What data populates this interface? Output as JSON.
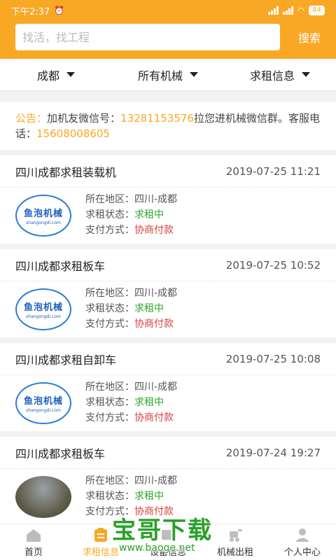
{
  "status": {
    "time": "下午2:37",
    "battery": "84"
  },
  "search": {
    "placeholder": "找活，找工程",
    "button": "搜索"
  },
  "filters": [
    {
      "label": "成都"
    },
    {
      "label": "所有机械"
    },
    {
      "label": "求租信息"
    }
  ],
  "notice": {
    "label": "公告：",
    "text1": "加机友微信号：",
    "wechat": "13281153576",
    "text2": "拉您进机械微信群。客服电话：",
    "phone": "15608008605"
  },
  "field_labels": {
    "region": "所在地区：",
    "status": "求租状态：",
    "payment": "支付方式："
  },
  "listings": [
    {
      "title": "四川成都求租装载机",
      "time": "2019-07-25 11:21",
      "region": "四川-成都",
      "status": "求租中",
      "payment": "协商付款",
      "thumb": "logo"
    },
    {
      "title": "四川成都求租板车",
      "time": "2019-07-25 10:52",
      "region": "四川-成都",
      "status": "求租中",
      "payment": "协商付款",
      "thumb": "logo"
    },
    {
      "title": "四川成都求租自卸车",
      "time": "2019-07-25 10:08",
      "region": "四川-成都",
      "status": "求租中",
      "payment": "协商付款",
      "thumb": "logo"
    },
    {
      "title": "四川成都求租板车",
      "time": "2019-07-24 19:27",
      "region": "四川-成都",
      "status": "求租中",
      "payment": "协商付款",
      "thumb": "photo"
    }
  ],
  "logo": {
    "name": "鱼泡机械",
    "domain": "shangongdi.com"
  },
  "tabs": [
    {
      "label": "首页",
      "icon": "home-icon"
    },
    {
      "label": "求租信息",
      "icon": "clipboard-icon"
    },
    {
      "label": "设备信息",
      "icon": "device-icon"
    },
    {
      "label": "机械出租",
      "icon": "excavator-icon"
    },
    {
      "label": "个人中心",
      "icon": "person-icon"
    }
  ],
  "watermark": {
    "main": "宝哥下载",
    "url": "www.baoge.net"
  },
  "colors": {
    "accent": "#f9a825",
    "status_green": "#2aa52a",
    "payment_red": "#d94040"
  }
}
